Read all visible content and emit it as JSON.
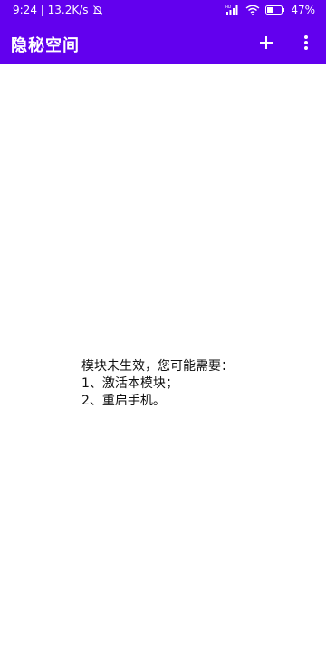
{
  "status_bar": {
    "time_speed": "9:24 | 13.2K/s",
    "battery_percent": "47%",
    "battery_level": 0.47,
    "icons": [
      "mute-bell-icon",
      "signal-icon",
      "wifi-icon",
      "battery-icon"
    ]
  },
  "toolbar": {
    "title": "隐秘空间",
    "add_icon": "plus-icon",
    "more_icon": "more-vertical-icon"
  },
  "message": {
    "line1": "模块未生效，您可能需要：",
    "line2": "1、激活本模块；",
    "line3": "2、重启手机。"
  },
  "colors": {
    "app_bar": "#6200EE",
    "background": "#FFFFFF",
    "text": "#111111"
  }
}
